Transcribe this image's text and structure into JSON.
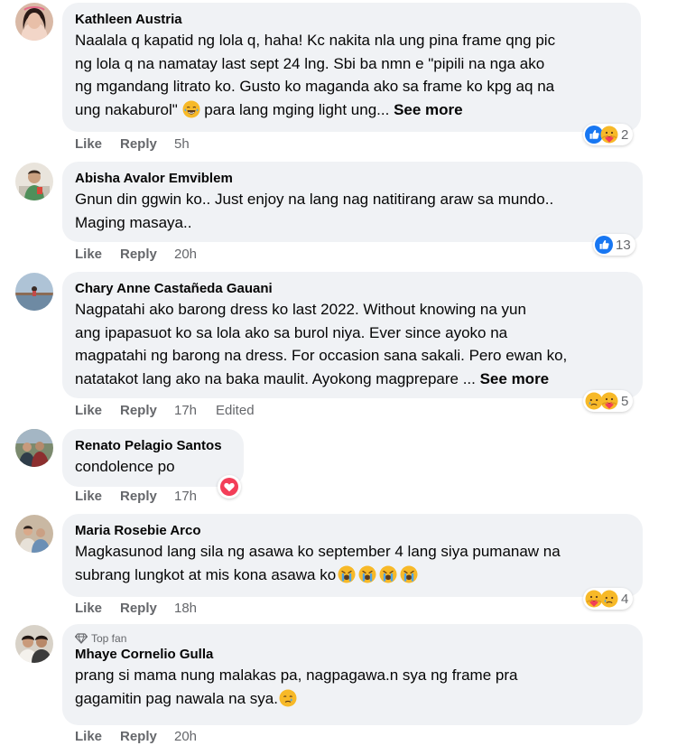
{
  "actions": {
    "like": "Like",
    "reply": "Reply",
    "edited": "Edited"
  },
  "comments": [
    {
      "name": "Kathleen Austria",
      "lines": [
        "Naalala q kapatid ng lola q, haha! Kc nakita nla ung pina frame qng pic",
        "ng lola q na namatay last sept 24 lng. Sbi ba nmn e \"pipili na nga ako",
        "ng mgandang litrato ko. Gusto ko maganda ako sa frame ko kpg aq na",
        "ung nakaburol\""
      ],
      "last_line_after_emoji": " para lang mging light ung... ",
      "see_more": "See more",
      "time": "5h",
      "reaction_count": "2",
      "reactions": [
        "like",
        "care"
      ]
    },
    {
      "name": "Abisha Avalor Emviblem",
      "lines": [
        "Gnun din ggwin ko.. Just enjoy na lang nag natitirang araw sa mundo..",
        "Maging masaya.."
      ],
      "time": "20h",
      "reaction_count": "13",
      "reactions": [
        "like"
      ]
    },
    {
      "name": "Chary Anne Castañeda Gauani",
      "lines": [
        "Nagpatahi ako barong dress ko last 2022. Without knowing na yun",
        "ang ipapasuot ko sa lola ako sa burol niya. Ever since ayoko na",
        "magpatahi ng barong na dress. For occasion sana sakali. Pero ewan ko,",
        "natatakot lang ako na baka maulit. Ayokong magprepare ... "
      ],
      "see_more": "See more",
      "time": "17h",
      "reaction_count": "5",
      "reactions": [
        "sad",
        "care"
      ]
    },
    {
      "name": "Renato Pelagio Santos",
      "lines": [
        "condolence po"
      ],
      "time": "17h",
      "reactions": [
        "love"
      ]
    },
    {
      "name": "Maria Rosebie Arco",
      "lines": [
        "Magkasunod lang sila ng asawa ko september 4 lang siya pumanaw na",
        "subrang lungkot at mis kona asawa ko"
      ],
      "time": "18h",
      "reaction_count": "4",
      "reactions": [
        "care",
        "sad"
      ]
    },
    {
      "top_fan_label": "Top fan",
      "name": "Mhaye Cornelio Gulla",
      "lines": [
        "prang si mama nung malakas pa, nagpagawa.n sya ng frame pra",
        "gagamitin pag nawala na sya."
      ],
      "time": "20h"
    }
  ],
  "colors": {
    "bubble": "#f0f2f5",
    "muted_text": "#65676b",
    "like_blue": "#1877f2",
    "love_red": "#f33e58",
    "emoji_yellow": "#f7b928"
  }
}
